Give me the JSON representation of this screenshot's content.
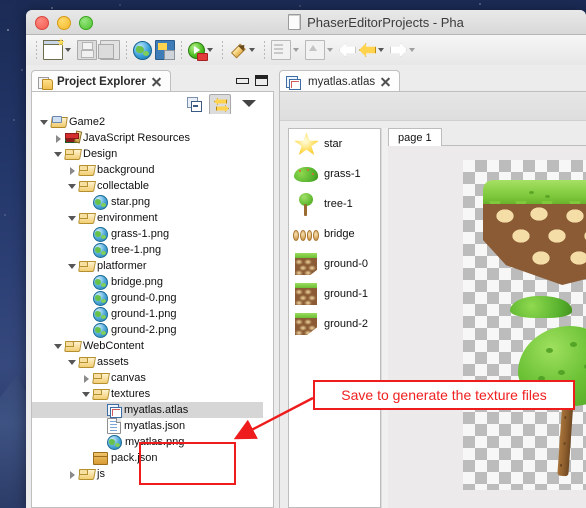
{
  "window": {
    "title": "PhaserEditorProjects - Pha",
    "title_icon": "document-icon",
    "controls": {
      "close": "close",
      "minimize": "minimize",
      "zoom": "zoom"
    }
  },
  "toolbar": {
    "items": [
      {
        "icon": "new-file-icon",
        "label": "New",
        "has_dropdown": true,
        "enabled": true
      },
      {
        "icon": "save-icon",
        "label": "Save",
        "has_dropdown": false,
        "enabled": false
      },
      {
        "icon": "save-all-icon",
        "label": "Save All",
        "has_dropdown": false,
        "enabled": false
      },
      {
        "icon": "globe-icon",
        "label": "Open Browser",
        "has_dropdown": false,
        "enabled": true
      },
      {
        "icon": "web-server-icon",
        "label": "Web Server",
        "has_dropdown": false,
        "enabled": true
      },
      {
        "icon": "run-icon",
        "label": "Run",
        "has_dropdown": true,
        "enabled": true
      },
      {
        "icon": "pencil-icon",
        "label": "Edit",
        "has_dropdown": true,
        "enabled": true
      },
      {
        "icon": "document-gray-icon",
        "label": "New JavaScript",
        "has_dropdown": true,
        "enabled": false
      },
      {
        "icon": "export-gray-icon",
        "label": "Export",
        "has_dropdown": true,
        "enabled": false
      },
      {
        "icon": "back-gray-icon",
        "label": "Back",
        "has_dropdown": false,
        "enabled": false
      },
      {
        "icon": "back-yellow-icon",
        "label": "Previous",
        "has_dropdown": true,
        "enabled": true
      },
      {
        "icon": "forward-gray-icon",
        "label": "Next",
        "has_dropdown": true,
        "enabled": false
      }
    ]
  },
  "explorer": {
    "tab_label": "Project Explorer",
    "tab_icon": "project-explorer-icon",
    "close_icon": "close-icon",
    "minimize_icon": "minimize-view-icon",
    "maximize_icon": "maximize-view-icon",
    "view_toolbar": [
      {
        "name": "collapse-all-button",
        "icon": "collapse-all-icon",
        "pressed": false
      },
      {
        "name": "link-with-editor-button",
        "icon": "link-with-editor-icon",
        "pressed": true
      },
      {
        "name": "view-menu-button",
        "icon": "view-menu-icon",
        "pressed": false
      }
    ],
    "tree": [
      {
        "label": "Game2",
        "icon": "project-icon",
        "indent": 0,
        "twisty": "open",
        "selected": false
      },
      {
        "label": "JavaScript Resources",
        "icon": "library-icon",
        "indent": 1,
        "twisty": "closed",
        "selected": false
      },
      {
        "label": "Design",
        "icon": "folder-icon",
        "indent": 1,
        "twisty": "open",
        "selected": false
      },
      {
        "label": "background",
        "icon": "folder-icon",
        "indent": 2,
        "twisty": "closed",
        "selected": false
      },
      {
        "label": "collectable",
        "icon": "folder-icon",
        "indent": 2,
        "twisty": "open",
        "selected": false
      },
      {
        "label": "star.png",
        "icon": "image-icon",
        "indent": 3,
        "twisty": "none",
        "selected": false
      },
      {
        "label": "environment",
        "icon": "folder-icon",
        "indent": 2,
        "twisty": "open",
        "selected": false
      },
      {
        "label": "grass-1.png",
        "icon": "image-icon",
        "indent": 3,
        "twisty": "none",
        "selected": false
      },
      {
        "label": "tree-1.png",
        "icon": "image-icon",
        "indent": 3,
        "twisty": "none",
        "selected": false
      },
      {
        "label": "platformer",
        "icon": "folder-icon",
        "indent": 2,
        "twisty": "open",
        "selected": false
      },
      {
        "label": "bridge.png",
        "icon": "image-icon",
        "indent": 3,
        "twisty": "none",
        "selected": false
      },
      {
        "label": "ground-0.png",
        "icon": "image-icon",
        "indent": 3,
        "twisty": "none",
        "selected": false
      },
      {
        "label": "ground-1.png",
        "icon": "image-icon",
        "indent": 3,
        "twisty": "none",
        "selected": false
      },
      {
        "label": "ground-2.png",
        "icon": "image-icon",
        "indent": 3,
        "twisty": "none",
        "selected": false
      },
      {
        "label": "WebContent",
        "icon": "folder-icon",
        "indent": 1,
        "twisty": "open",
        "selected": false
      },
      {
        "label": "assets",
        "icon": "folder-icon",
        "indent": 2,
        "twisty": "open",
        "selected": false
      },
      {
        "label": "canvas",
        "icon": "folder-icon",
        "indent": 3,
        "twisty": "closed",
        "selected": false
      },
      {
        "label": "textures",
        "icon": "folder-icon",
        "indent": 3,
        "twisty": "open",
        "selected": false
      },
      {
        "label": "myatlas.atlas",
        "icon": "atlas-icon",
        "indent": 4,
        "twisty": "none",
        "selected": true
      },
      {
        "label": "myatlas.json",
        "icon": "json-icon",
        "indent": 4,
        "twisty": "none",
        "selected": false
      },
      {
        "label": "myatlas.png",
        "icon": "image-icon",
        "indent": 4,
        "twisty": "none",
        "selected": false
      },
      {
        "label": "pack.json",
        "icon": "pack-icon",
        "indent": 3,
        "twisty": "none",
        "selected": false
      },
      {
        "label": "js",
        "icon": "folder-icon",
        "indent": 2,
        "twisty": "closed",
        "selected": false
      }
    ]
  },
  "editor": {
    "tab_label": "myatlas.atlas",
    "tab_icon": "atlas-icon",
    "close_icon": "close-icon",
    "assets": [
      {
        "label": "star",
        "sprite": "star-sprite"
      },
      {
        "label": "grass-1",
        "sprite": "grass-sprite"
      },
      {
        "label": "tree-1",
        "sprite": "tree-sprite"
      },
      {
        "label": "bridge",
        "sprite": "bridge-sprite"
      },
      {
        "label": "ground-0",
        "sprite": "ground0-sprite"
      },
      {
        "label": "ground-1",
        "sprite": "ground1-sprite"
      },
      {
        "label": "ground-2",
        "sprite": "ground2-sprite"
      }
    ],
    "page_tab_label": "page 1"
  },
  "annotation": {
    "callout_text": "Save to generate the texture files",
    "color": "#ee1c1c"
  },
  "colors": {
    "accent_red": "#ee1c1c",
    "selection_gray": "#d6d6d6",
    "window_chrome": "#ececec",
    "desktop": "#223567"
  }
}
